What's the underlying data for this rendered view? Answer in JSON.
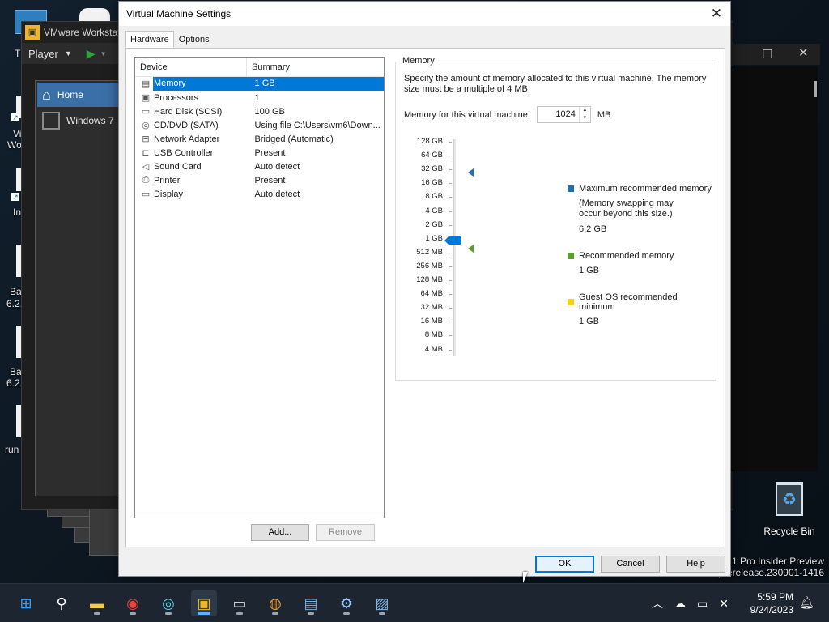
{
  "desktop": {
    "labels": [
      "T",
      "Vi",
      "Wo",
      "In",
      "Ba",
      "6.2.",
      "Ba",
      "6.2.",
      "run"
    ],
    "recycle_bin": "Recycle Bin",
    "watermark_line1": "11 Pro Insider Preview",
    "watermark_line2": "prerelease.230901-1416"
  },
  "vmware": {
    "title": "VMware Workstati",
    "player_menu": "Player",
    "library": [
      {
        "label": "Home",
        "icon": "home-icon"
      },
      {
        "label": "Windows 7",
        "icon": "vm-icon"
      }
    ]
  },
  "dialog": {
    "title": "Virtual Machine Settings",
    "tabs": [
      "Hardware",
      "Options"
    ],
    "columns": [
      "Device",
      "Summary"
    ],
    "devices": [
      {
        "name": "Memory",
        "summary": "1 GB",
        "icon": "memory-icon",
        "selected": true
      },
      {
        "name": "Processors",
        "summary": "1",
        "icon": "processor-icon"
      },
      {
        "name": "Hard Disk (SCSI)",
        "summary": "100 GB",
        "icon": "hard-disk-icon"
      },
      {
        "name": "CD/DVD (SATA)",
        "summary": "Using file C:\\Users\\vm6\\Down...",
        "icon": "cd-dvd-icon"
      },
      {
        "name": "Network Adapter",
        "summary": "Bridged (Automatic)",
        "icon": "network-adapter-icon"
      },
      {
        "name": "USB Controller",
        "summary": "Present",
        "icon": "usb-icon"
      },
      {
        "name": "Sound Card",
        "summary": "Auto detect",
        "icon": "sound-card-icon"
      },
      {
        "name": "Printer",
        "summary": "Present",
        "icon": "printer-icon"
      },
      {
        "name": "Display",
        "summary": "Auto detect",
        "icon": "display-icon"
      }
    ],
    "add_button": "Add...",
    "remove_button": "Remove",
    "ok_button": "OK",
    "cancel_button": "Cancel",
    "help_button": "Help"
  },
  "memory": {
    "group_title": "Memory",
    "description": "Specify the amount of memory allocated to this virtual machine. The memory size must be a multiple of 4 MB.",
    "field_label": "Memory for this virtual machine:",
    "value": "1024",
    "unit": "MB",
    "scale": [
      "128 GB",
      "64 GB",
      "32 GB",
      "16 GB",
      "8 GB",
      "4 GB",
      "2 GB",
      "1 GB",
      "512 MB",
      "256 MB",
      "128 MB",
      "64 MB",
      "32 MB",
      "16 MB",
      "8 MB",
      "4 MB"
    ],
    "legend": [
      {
        "label": "Maximum recommended memory",
        "note": "(Memory swapping may occur beyond this size.)",
        "value": "6.2 GB",
        "color": "#1f6fb8"
      },
      {
        "label": "Recommended memory",
        "value": "1 GB",
        "color": "#57a02b"
      },
      {
        "label": "Guest OS recommended minimum",
        "value": "1 GB",
        "color": "#f2d21b"
      }
    ]
  },
  "taskbar": {
    "apps": [
      {
        "name": "start-button",
        "glyph": "⊞"
      },
      {
        "name": "search-button",
        "glyph": "⚲"
      },
      {
        "name": "file-explorer-icon",
        "glyph": "▬"
      },
      {
        "name": "chrome-icon",
        "glyph": "◉"
      },
      {
        "name": "app-icon",
        "glyph": "◎"
      },
      {
        "name": "vmware-icon",
        "glyph": "▣"
      },
      {
        "name": "terminal-icon",
        "glyph": "▭"
      },
      {
        "name": "disc-burner-icon",
        "glyph": "◍"
      },
      {
        "name": "keyboard-app-icon",
        "glyph": "▤"
      },
      {
        "name": "settings-icon",
        "glyph": "⚙"
      },
      {
        "name": "resource-monitor-icon",
        "glyph": "▨"
      }
    ],
    "time": "5:59 PM",
    "date": "9/24/2023"
  }
}
